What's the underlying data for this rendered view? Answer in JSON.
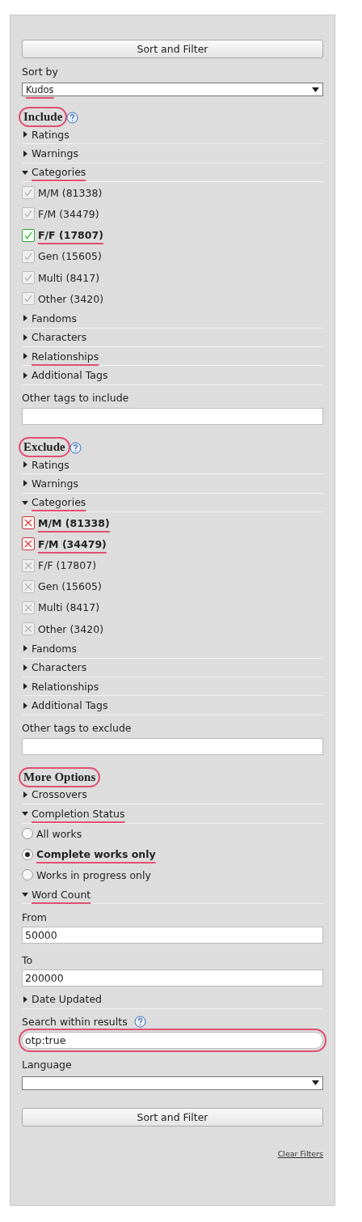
{
  "top_button": "Sort and Filter",
  "rows": [
    {
      "kind": "label",
      "text": "Sort by"
    },
    {
      "kind": "select",
      "value": "Kudos",
      "underlined": true
    },
    {
      "kind": "heading",
      "text": "Include",
      "help": true,
      "circled": true
    },
    {
      "kind": "group",
      "label": "Ratings",
      "expanded": false
    },
    {
      "kind": "group",
      "label": "Warnings",
      "expanded": false
    },
    {
      "kind": "group",
      "label": "Categories",
      "expanded": true,
      "underlined": true
    },
    {
      "kind": "include_check",
      "label": "M/M (81338)",
      "checked": false
    },
    {
      "kind": "include_check",
      "label": "F/M (34479)",
      "checked": false
    },
    {
      "kind": "include_check",
      "label": "F/F (17807)",
      "checked": true,
      "underlined": true
    },
    {
      "kind": "include_check",
      "label": "Gen (15605)",
      "checked": false
    },
    {
      "kind": "include_check",
      "label": "Multi (8417)",
      "checked": false
    },
    {
      "kind": "include_check",
      "label": "Other (3420)",
      "checked": false
    },
    {
      "kind": "group",
      "label": "Fandoms",
      "expanded": false
    },
    {
      "kind": "group",
      "label": "Characters",
      "expanded": false
    },
    {
      "kind": "group",
      "label": "Relationships",
      "expanded": false,
      "underlined": true
    },
    {
      "kind": "group",
      "label": "Additional Tags",
      "expanded": false
    },
    {
      "kind": "label",
      "text": "Other tags to include"
    },
    {
      "kind": "field",
      "value": ""
    },
    {
      "kind": "heading",
      "text": "Exclude",
      "help": true,
      "circled": true
    },
    {
      "kind": "group",
      "label": "Ratings",
      "expanded": false
    },
    {
      "kind": "group",
      "label": "Warnings",
      "expanded": false
    },
    {
      "kind": "group",
      "label": "Categories",
      "expanded": true,
      "underlined": true
    },
    {
      "kind": "exclude_check",
      "label": "M/M (81338)",
      "checked": true,
      "underlined": true
    },
    {
      "kind": "exclude_check",
      "label": "F/M (34479)",
      "checked": true,
      "underlined": true
    },
    {
      "kind": "exclude_check",
      "label": "F/F (17807)",
      "checked": false
    },
    {
      "kind": "exclude_check",
      "label": "Gen (15605)",
      "checked": false
    },
    {
      "kind": "exclude_check",
      "label": "Multi (8417)",
      "checked": false
    },
    {
      "kind": "exclude_check",
      "label": "Other (3420)",
      "checked": false
    },
    {
      "kind": "group",
      "label": "Fandoms",
      "expanded": false
    },
    {
      "kind": "group",
      "label": "Characters",
      "expanded": false
    },
    {
      "kind": "group",
      "label": "Relationships",
      "expanded": false
    },
    {
      "kind": "group",
      "label": "Additional Tags",
      "expanded": false
    },
    {
      "kind": "label",
      "text": "Other tags to exclude"
    },
    {
      "kind": "field",
      "value": ""
    },
    {
      "kind": "heading",
      "text": "More Options",
      "circled": true
    },
    {
      "kind": "group",
      "label": "Crossovers",
      "expanded": false
    },
    {
      "kind": "group",
      "label": "Completion Status",
      "expanded": true,
      "underlined": true
    },
    {
      "kind": "radio",
      "label": "All works",
      "selected": false
    },
    {
      "kind": "radio",
      "label": "Complete works only",
      "selected": true,
      "underlined": true
    },
    {
      "kind": "radio",
      "label": "Works in progress only",
      "selected": false
    },
    {
      "kind": "group",
      "label": "Word Count",
      "expanded": true,
      "underlined": true
    },
    {
      "kind": "label",
      "text": "From"
    },
    {
      "kind": "field",
      "value": "50000"
    },
    {
      "kind": "label",
      "text": "To"
    },
    {
      "kind": "field",
      "value": "200000"
    },
    {
      "kind": "group",
      "label": "Date Updated",
      "expanded": false
    },
    {
      "kind": "label",
      "text": "Search within results",
      "help": true
    },
    {
      "kind": "field",
      "value": "otp:true",
      "circled": true
    },
    {
      "kind": "label",
      "text": "Language"
    },
    {
      "kind": "select",
      "value": ""
    }
  ],
  "bottom_button": "Sort and Filter",
  "clear_link": "Clear Filters"
}
